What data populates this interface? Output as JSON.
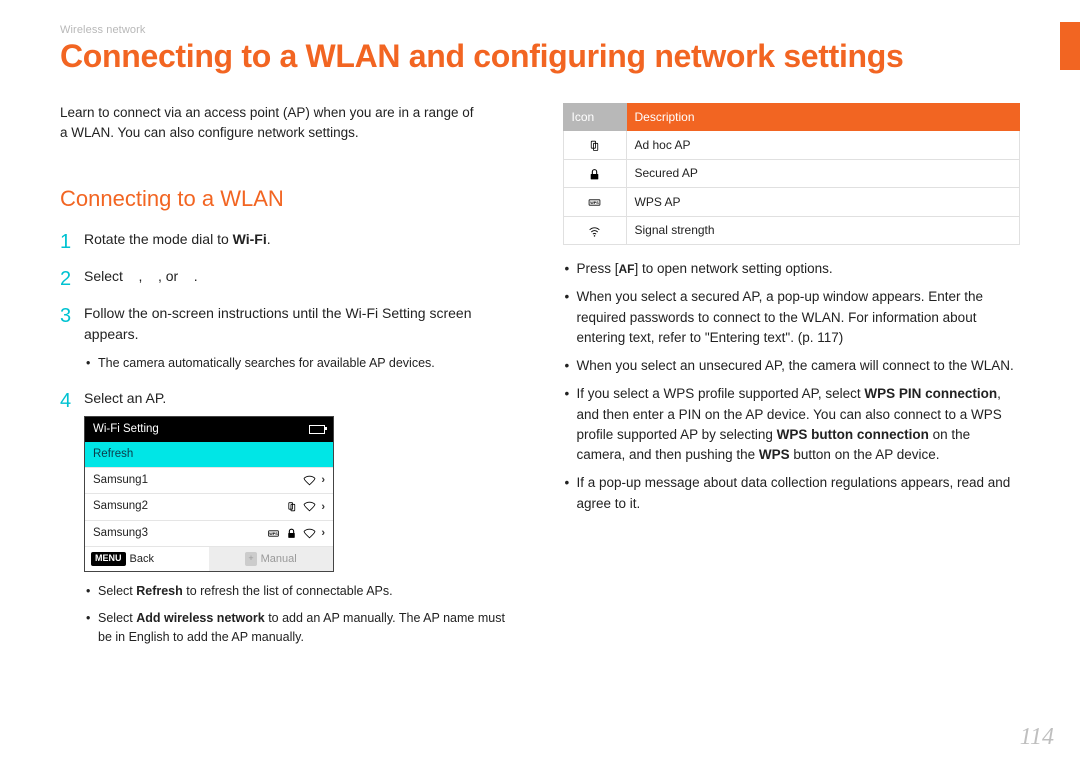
{
  "breadcrumb": "Wireless network",
  "page_title": "Connecting to a WLAN and configuring network settings",
  "intro": "Learn to connect via an access point (AP) when you are in a range of a WLAN. You can also configure network settings.",
  "section_heading": "Connecting to a WLAN",
  "steps": {
    "s1_a": "Rotate the mode dial to ",
    "s1_b": "Wi-Fi",
    "s1_c": ".",
    "s2_a": "Select ",
    "s2_b": ", ",
    "s2_c": ", or ",
    "s2_d": ".",
    "s3": "Follow the on-screen instructions until the Wi-Fi Setting screen appears.",
    "s3_bullet": "The camera automatically searches for available AP devices.",
    "s4": "Select an AP."
  },
  "wifi_box": {
    "title": "Wi-Fi Setting",
    "refresh": "Refresh",
    "rows": [
      "Samsung1",
      "Samsung2",
      "Samsung3"
    ],
    "footer_menu": "MENU",
    "footer_back": "Back",
    "footer_right_prefix": "+",
    "footer_right": "Manual"
  },
  "post_box_bullets": [
    {
      "pre": "Select ",
      "bold": "Refresh",
      "post": " to refresh the list of connectable APs."
    },
    {
      "pre": "Select ",
      "bold": "Add wireless network",
      "post": " to add an AP manually. The AP name must be in English to add the AP manually."
    }
  ],
  "icon_table": {
    "h_icon": "Icon",
    "h_desc": "Description",
    "rows": [
      {
        "icon": "adhoc",
        "desc": "Ad hoc AP"
      },
      {
        "icon": "lock",
        "desc": "Secured AP"
      },
      {
        "icon": "wps",
        "desc": "WPS AP"
      },
      {
        "icon": "signal",
        "desc": "Signal strength"
      }
    ]
  },
  "right_bullets": {
    "b1_a": "Press [",
    "b1_af": "AF",
    "b1_b": "] to open network setting options.",
    "b2": "When you select a secured AP, a pop-up window appears. Enter the required passwords to connect to the WLAN. For information about entering text, refer to \"Entering text\". (p. 117)",
    "b3": "When you select an unsecured AP, the camera will connect to the WLAN.",
    "b4_a": "If you select a WPS profile supported AP, select ",
    "b4_bold1": "WPS PIN connection",
    "b4_b": ", and then enter a PIN on the AP device. You can also connect to a WPS profile supported AP by selecting ",
    "b4_bold2": "WPS button connection",
    "b4_c": " on the camera, and then pushing the ",
    "b4_bold3": "WPS",
    "b4_d": " button on the AP device.",
    "b5": "If a pop-up message about data collection regulations appears, read and agree to it."
  },
  "page_number": "114"
}
